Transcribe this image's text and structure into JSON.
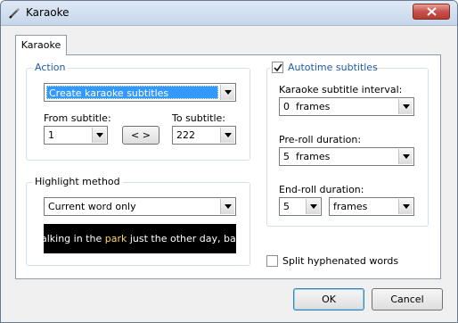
{
  "window": {
    "title": "Karaoke",
    "icon": "pen-icon",
    "close_icon": "close-icon"
  },
  "tab": {
    "label": "Karaoke"
  },
  "action": {
    "legend": "Action",
    "mode_value": "Create karaoke subtitles",
    "from_label": "From subtitle:",
    "from_value": "1",
    "swap_label": "< >",
    "to_label": "To subtitle:",
    "to_value": "222"
  },
  "highlight": {
    "legend": "Highlight method",
    "method_value": "Current word only",
    "preview_before": "Walking in the ",
    "preview_highlight": "park",
    "preview_after": " just the other day, baby",
    "highlight_color": "#ffd94a"
  },
  "autotime": {
    "legend": "Autotime subtitles",
    "checked": true,
    "interval_label": "Karaoke subtitle interval:",
    "interval_value": "0  frames",
    "preroll_label": "Pre-roll duration:",
    "preroll_value": "5  frames",
    "endroll_label": "End-roll duration:",
    "endroll_number": "5",
    "endroll_unit": "frames"
  },
  "split": {
    "label": "Split hyphenated words",
    "checked": false
  },
  "buttons": {
    "ok": "OK",
    "cancel": "Cancel"
  },
  "colors": {
    "legend_blue": "#1e5aa8",
    "selection_blue": "#3399ff"
  }
}
